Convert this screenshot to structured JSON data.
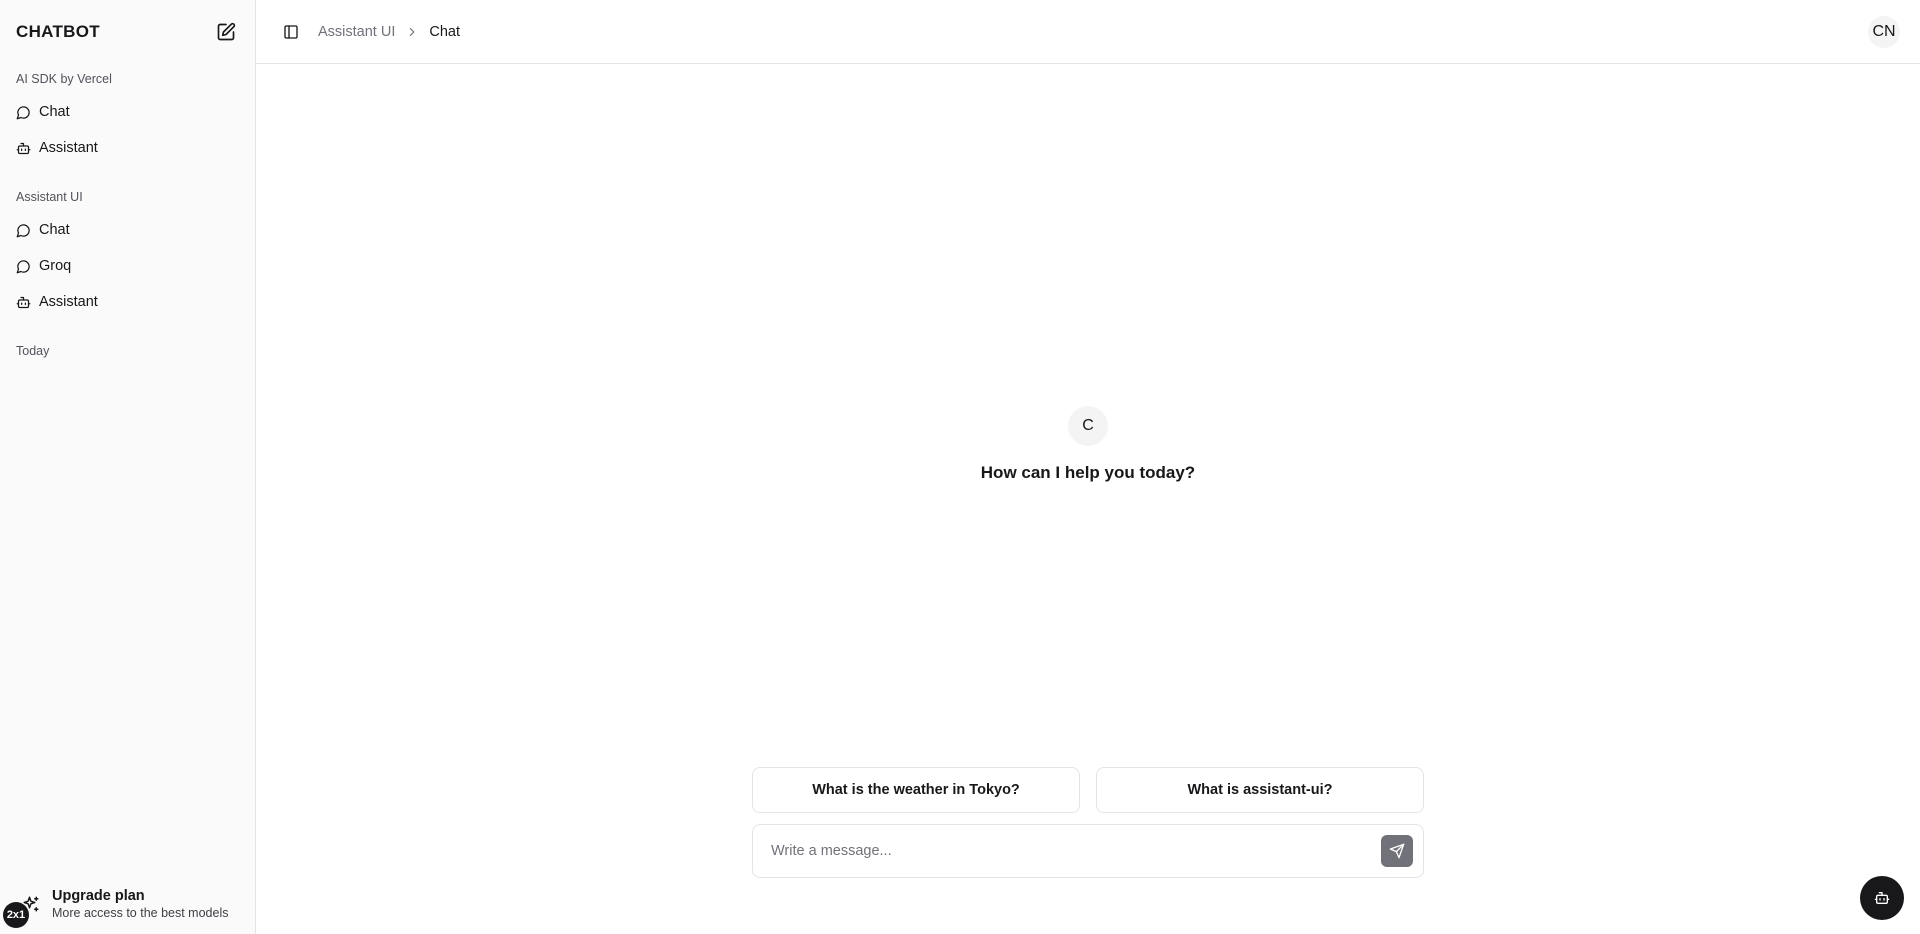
{
  "sidebar": {
    "brand": "CHATBOT",
    "groups": [
      {
        "label": "AI SDK by Vercel",
        "items": [
          {
            "label": "Chat",
            "icon": "message-circle-icon"
          },
          {
            "label": "Assistant",
            "icon": "bot-icon"
          }
        ]
      },
      {
        "label": "Assistant UI",
        "items": [
          {
            "label": "Chat",
            "icon": "message-circle-icon"
          },
          {
            "label": "Groq",
            "icon": "message-circle-icon"
          },
          {
            "label": "Assistant",
            "icon": "bot-icon"
          }
        ]
      }
    ],
    "history_label": "Today",
    "upgrade": {
      "title": "Upgrade plan",
      "subtitle": "More access to the best models"
    },
    "badge": "2x1"
  },
  "topbar": {
    "breadcrumb": {
      "parent": "Assistant UI",
      "current": "Chat"
    },
    "avatar_initials": "CN"
  },
  "welcome": {
    "avatar_letter": "C",
    "message": "How can I help you today?"
  },
  "suggestions": [
    {
      "label": "What is the weather in Tokyo?"
    },
    {
      "label": "What is assistant-ui?"
    }
  ],
  "composer": {
    "placeholder": "Write a message...",
    "value": ""
  },
  "colors": {
    "sidebar_bg": "#fafafa",
    "border": "#e4e4e7",
    "text": "#18181b",
    "muted": "#71717a",
    "send_button": "#71717a",
    "fab": "#18181b"
  }
}
